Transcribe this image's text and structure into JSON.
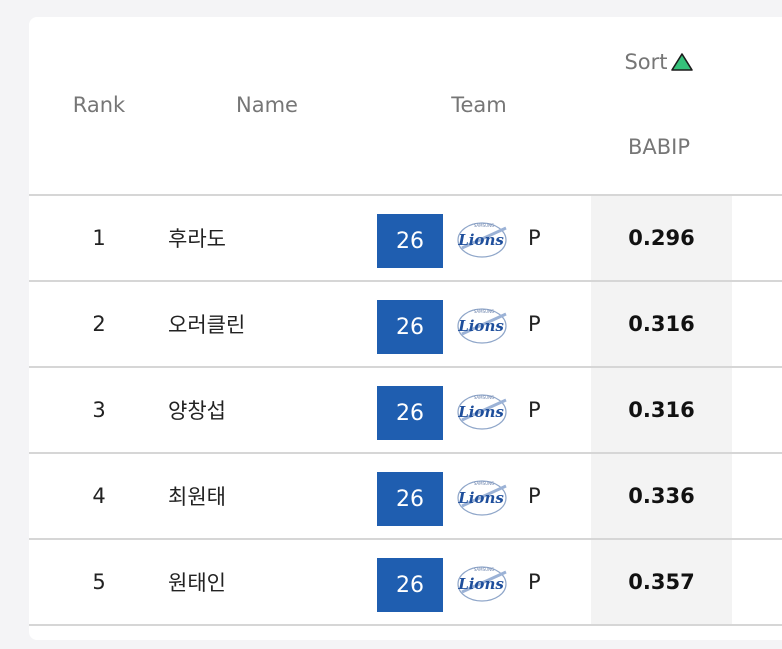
{
  "header": {
    "rank": "Rank",
    "name": "Name",
    "team": "Team",
    "sort_label": "Sort",
    "sort_icon": "triangle-up-icon",
    "stat": "BABIP"
  },
  "colors": {
    "team_badge": "#1f5eb0",
    "sort_icon": "#35c17a",
    "stat_column_bg": "#f3f3f3"
  },
  "rows": [
    {
      "rank": "1",
      "name": "후라도",
      "team_number": "26",
      "team_logo": "Lions",
      "position": "P",
      "babip": "0.296"
    },
    {
      "rank": "2",
      "name": "오러클린",
      "team_number": "26",
      "team_logo": "Lions",
      "position": "P",
      "babip": "0.316"
    },
    {
      "rank": "3",
      "name": "양창섭",
      "team_number": "26",
      "team_logo": "Lions",
      "position": "P",
      "babip": "0.316"
    },
    {
      "rank": "4",
      "name": "최원태",
      "team_number": "26",
      "team_logo": "Lions",
      "position": "P",
      "babip": "0.336"
    },
    {
      "rank": "5",
      "name": "원태인",
      "team_number": "26",
      "team_logo": "Lions",
      "position": "P",
      "babip": "0.357"
    }
  ]
}
